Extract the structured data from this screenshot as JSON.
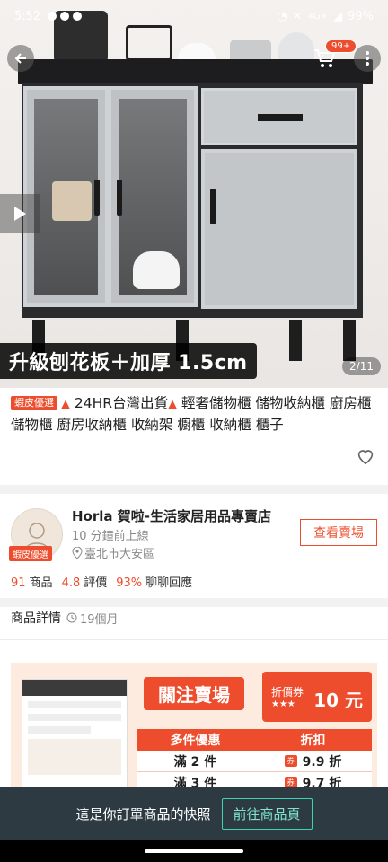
{
  "status_bar": {
    "time": "5:52",
    "network": "4G+",
    "battery": "99%"
  },
  "hero": {
    "promo_text": "升級刨花板＋加厚 1.5cm",
    "page_indicator": "2/11",
    "cart_count": "99+"
  },
  "product": {
    "badge": "蝦皮優選",
    "title_part1": "▲",
    "title_part2": " 24HR台灣出貨",
    "title_part3": "▲",
    "title_part4": " 輕奢儲物櫃 儲物收納櫃 廚房櫃 儲物櫃 廚房收納櫃 收納架 櫥櫃 收納櫃 櫃子"
  },
  "shop": {
    "name": "Horla 賀啦-生活家居用品專賣店",
    "online": "10 分鐘前上線",
    "location": "臺北市大安區",
    "avatar_badge": "蝦皮優選",
    "view_button": "查看賣場",
    "stats": {
      "products_count": "91",
      "products_label": "商品",
      "rating": "4.8",
      "rating_label": "評價",
      "response": "93%",
      "response_label": "聊聊回應"
    }
  },
  "details": {
    "label": "商品詳情",
    "age": "19個月"
  },
  "banner": {
    "follow_text": "關注賣場",
    "coupon_label": "折價券",
    "coupon_value": "10 元",
    "table_head": [
      "多件優惠",
      "折扣"
    ],
    "rows": [
      {
        "qty": "滿 2 件",
        "discount": "9.9 折"
      },
      {
        "qty": "滿 3 件",
        "discount": "9.7 折"
      }
    ]
  },
  "bottom_bar": {
    "message": "這是你訂單商品的快照",
    "button": "前往商品頁"
  },
  "colors": {
    "accent": "#ee4d2d",
    "bottom_bar": "#2e3a42",
    "teal": "#3fd3b5"
  }
}
